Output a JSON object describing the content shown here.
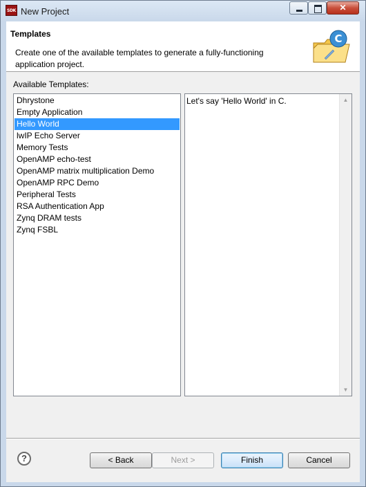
{
  "window": {
    "app_icon_text": "SDK",
    "title": "New Project",
    "close_glyph": "✕"
  },
  "header": {
    "title": "Templates",
    "description": "Create one of the available templates to generate a fully-functioning application project.",
    "icon": "c-project-folder-icon"
  },
  "templates": {
    "label": "Available Templates:",
    "items": [
      {
        "label": "Dhrystone",
        "selected": false
      },
      {
        "label": "Empty Application",
        "selected": false
      },
      {
        "label": "Hello World",
        "selected": true
      },
      {
        "label": "lwIP Echo Server",
        "selected": false
      },
      {
        "label": "Memory Tests",
        "selected": false
      },
      {
        "label": "OpenAMP echo-test",
        "selected": false
      },
      {
        "label": "OpenAMP matrix multiplication Demo",
        "selected": false
      },
      {
        "label": "OpenAMP RPC Demo",
        "selected": false
      },
      {
        "label": "Peripheral Tests",
        "selected": false
      },
      {
        "label": "RSA Authentication App",
        "selected": false
      },
      {
        "label": "Zynq DRAM tests",
        "selected": false
      },
      {
        "label": "Zynq FSBL",
        "selected": false
      }
    ],
    "description": "Let's say 'Hello World' in C."
  },
  "buttons": {
    "help": "?",
    "back": "< Back",
    "next": "Next >",
    "finish": "Finish",
    "cancel": "Cancel"
  },
  "colors": {
    "selection": "#3399ff",
    "close_button": "#c9503b"
  }
}
